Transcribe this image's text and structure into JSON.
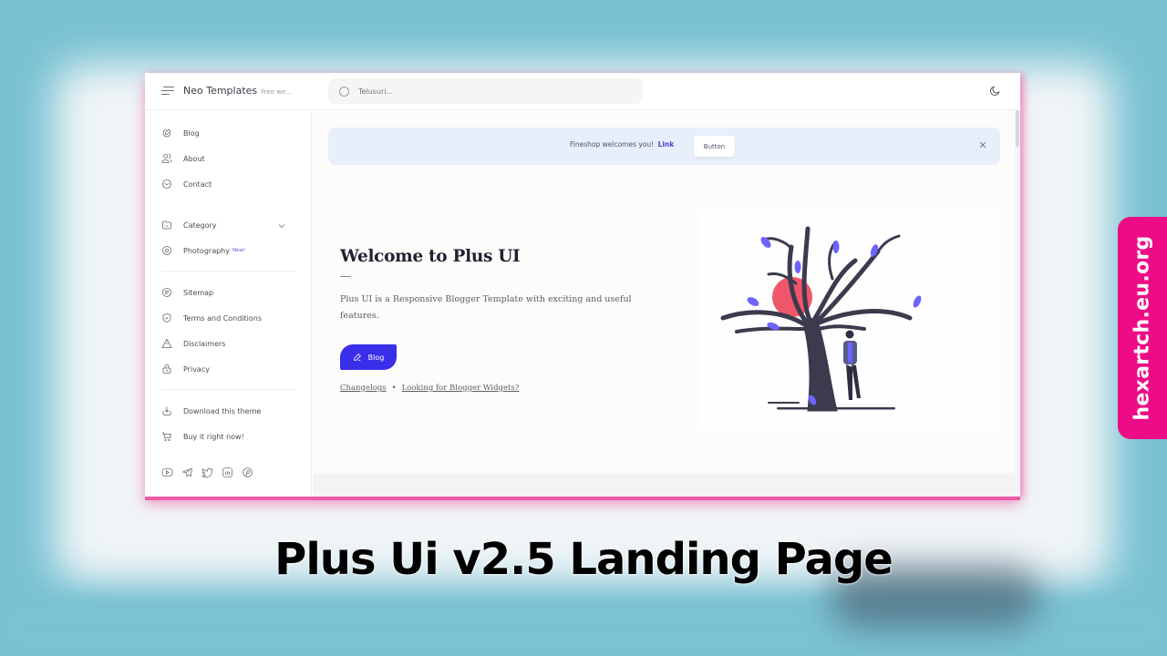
{
  "header": {
    "brand_name": "Neo Templates",
    "brand_tagline": "Free we...",
    "search_placeholder": "Telusuri..."
  },
  "sidebar": {
    "items": [
      {
        "label": "Blog",
        "icon": "pencil-circle-icon"
      },
      {
        "label": "About",
        "icon": "users-icon"
      },
      {
        "label": "Contact",
        "icon": "message-icon"
      },
      {
        "label": "Category",
        "icon": "folder-icon",
        "expandable": true
      },
      {
        "label": "Photography",
        "icon": "camera-icon",
        "badge": "New!"
      },
      {
        "label": "Sitemap",
        "icon": "document-icon"
      },
      {
        "label": "Terms and Conditions",
        "icon": "shield-check-icon"
      },
      {
        "label": "Disclaimers",
        "icon": "warning-icon"
      },
      {
        "label": "Privacy",
        "icon": "lock-icon"
      },
      {
        "label": "Download this theme",
        "icon": "download-icon"
      },
      {
        "label": "Buy it right now!",
        "icon": "cart-icon"
      }
    ],
    "social": [
      "youtube-icon",
      "telegram-icon",
      "twitter-icon",
      "linkedin-icon",
      "pinterest-icon"
    ]
  },
  "notice": {
    "text": "Fineshop welcomes you!",
    "link": "Link",
    "button": "Button"
  },
  "hero": {
    "title": "Welcome to Plus UI",
    "description": "Plus UI is a Responsive Blogger Template with exciting and useful features.",
    "button_label": "Blog",
    "links": [
      "Changelogs",
      "Looking for Blogger Widgets?"
    ],
    "separator": "•"
  },
  "colors": {
    "accent": "#3a2ee8",
    "notice_bg": "#e8effb",
    "watermark_bg": "#ee0c86",
    "frame_glow": "#ec5aa8",
    "backdrop": "#79c1d2"
  },
  "overlay": {
    "watermark": "hexartch.eu.org",
    "caption": "Plus Ui v2.5 Landing Page"
  }
}
